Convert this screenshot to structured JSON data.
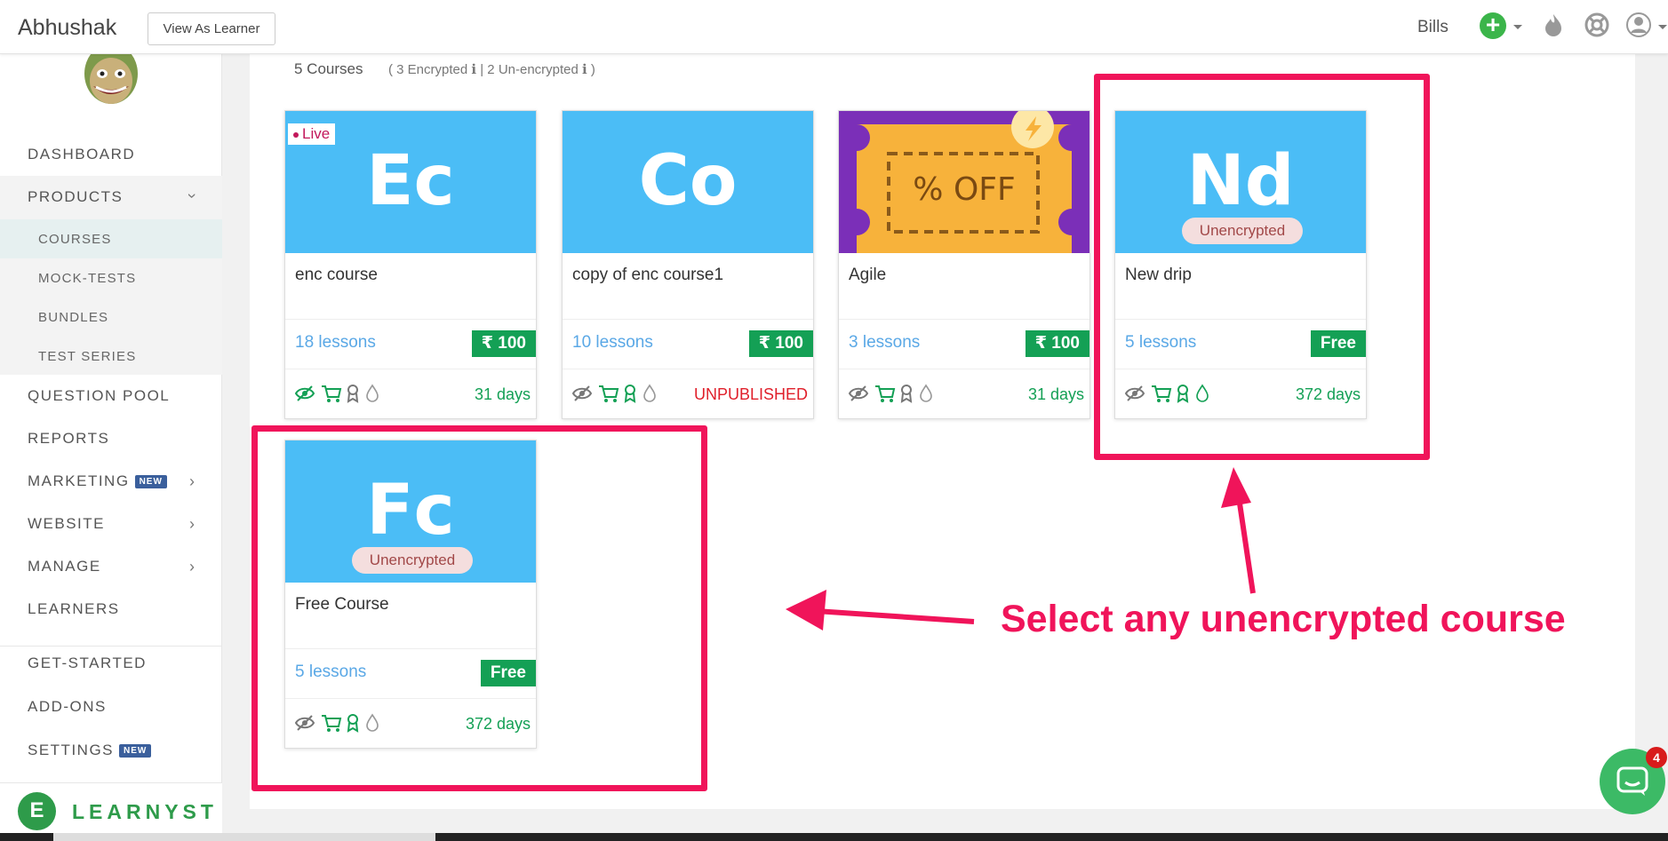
{
  "topbar": {
    "brand": "Abhushak",
    "view_as_learner": "View As Learner",
    "bills": "Bills",
    "plus": "+"
  },
  "sidebar": {
    "items": [
      {
        "label": "DASHBOARD"
      },
      {
        "label": "PRODUCTS"
      },
      {
        "label": "COURSES"
      },
      {
        "label": "MOCK-TESTS"
      },
      {
        "label": "BUNDLES"
      },
      {
        "label": "TEST SERIES"
      },
      {
        "label": "QUESTION POOL"
      },
      {
        "label": "REPORTS"
      },
      {
        "label": "MARKETING"
      },
      {
        "label": "WEBSITE"
      },
      {
        "label": "MANAGE"
      },
      {
        "label": "LEARNERS"
      },
      {
        "label": "GET-STARTED"
      },
      {
        "label": "ADD-ONS"
      },
      {
        "label": "SETTINGS"
      }
    ],
    "new_badge": "NEW",
    "logo_text": "LEARNYST",
    "logo_mark": "E"
  },
  "main": {
    "count": "5 Courses",
    "enc_info": "( 3 Encrypted ℹ | 2 Un-encrypted ℹ )"
  },
  "cards": [
    {
      "initials": "Ec",
      "title": "enc course",
      "lessons": "18 lessons",
      "price": "₹ 100",
      "status": "31 days",
      "tag": "Live"
    },
    {
      "initials": "Co",
      "title": "copy of enc course1",
      "lessons": "10 lessons",
      "price": "₹ 100",
      "status": "UNPUBLISHED"
    },
    {
      "title": "Agile",
      "lessons": "3 lessons",
      "price": "₹ 100",
      "status": "31 days",
      "coupon_text": "% OFF"
    },
    {
      "initials": "Nd",
      "title": "New drip",
      "lessons": "5 lessons",
      "price": "Free",
      "status": "372 days",
      "tag": "Unencrypted"
    },
    {
      "initials": "Fc",
      "title": "Free Course",
      "lessons": "5 lessons",
      "price": "Free",
      "status": "372 days",
      "tag": "Unencrypted"
    }
  ],
  "annotation": {
    "callout": "Select any unencrypted course",
    "color": "#f0145a"
  },
  "chat": {
    "count": "4"
  },
  "colors": {
    "thumb_blue": "#4bbdf6",
    "price_green": "#14a055",
    "lessons_blue": "#5aa8e6",
    "unpublished_red": "#e0202b"
  }
}
